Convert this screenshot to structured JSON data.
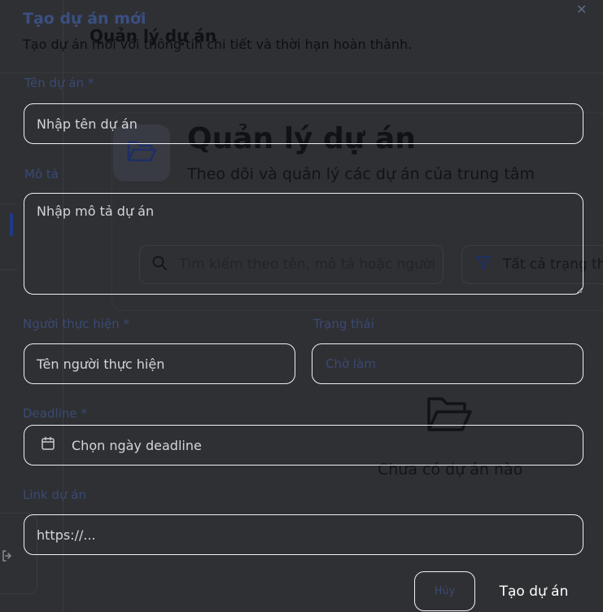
{
  "background": {
    "top_title": "Quản lý dự án",
    "header": {
      "title": "Quản lý dự án",
      "subtitle": "Theo dõi và quản lý các dự án của trung tâm",
      "icon": "folder-open-icon"
    },
    "search": {
      "placeholder": "Tìm kiếm theo tên, mô tả hoặc người",
      "icon": "search-icon"
    },
    "filter": {
      "label": "Tất cả trạng thái",
      "icon": "filter-icon"
    },
    "empty_state": {
      "text": "Chưa có dự án nào",
      "icon": "folder-open-icon"
    },
    "sidebar": {
      "logout_icon": "logout-icon"
    }
  },
  "modal": {
    "title": "Tạo dự án mới",
    "subtitle": "Tạo dự án mới với thông tin chi tiết và thời hạn hoàn thành.",
    "close_icon": "close-icon",
    "fields": {
      "name": {
        "label": "Tên dự án *",
        "placeholder": "Nhập tên dự án",
        "value": ""
      },
      "description": {
        "label": "Mô tả",
        "placeholder": "Nhập mô tả dự án",
        "value": ""
      },
      "assignee": {
        "label": "Người thực hiện *",
        "placeholder": "Tên người thực hiện",
        "value": ""
      },
      "status": {
        "label": "Trạng thái",
        "value": "Chờ làm"
      },
      "deadline": {
        "label": "Deadline *",
        "placeholder": "Chọn ngày deadline",
        "icon": "calendar-icon"
      },
      "link": {
        "label": "Link dự án",
        "placeholder": "https://...",
        "value": ""
      }
    },
    "buttons": {
      "cancel": "Hủy",
      "submit": "Tạo dự án"
    }
  },
  "colors": {
    "overlay": "#2f3033",
    "field_border": "#f1f1f3",
    "accent": "#1f3a8a"
  }
}
